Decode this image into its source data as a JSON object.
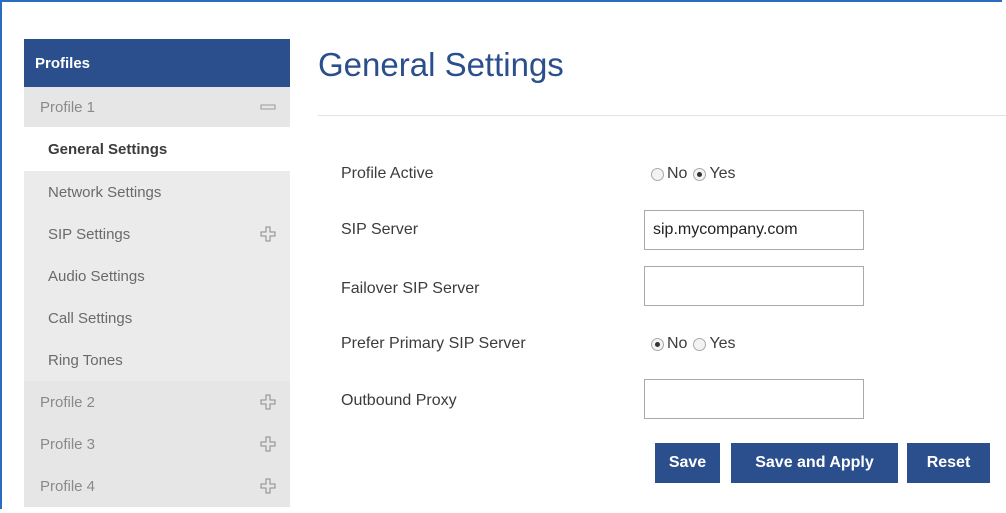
{
  "sidebar": {
    "header": "Profiles",
    "profile1": {
      "label": "Profile 1",
      "toggle_icon": "minus-icon"
    },
    "items": [
      {
        "label": "General Settings",
        "active": true
      },
      {
        "label": "Network Settings"
      },
      {
        "label": "SIP Settings",
        "toggle_icon": "plus-icon"
      },
      {
        "label": "Audio Settings"
      },
      {
        "label": "Call Settings"
      },
      {
        "label": "Ring Tones"
      }
    ],
    "profiles": [
      {
        "label": "Profile 2",
        "toggle_icon": "plus-icon"
      },
      {
        "label": "Profile 3",
        "toggle_icon": "plus-icon"
      },
      {
        "label": "Profile 4",
        "toggle_icon": "plus-icon"
      }
    ]
  },
  "main": {
    "title": "General Settings",
    "profile_active": {
      "label": "Profile Active",
      "no": "No",
      "yes": "Yes",
      "selected": "Yes"
    },
    "sip_server": {
      "label": "SIP Server",
      "value": "sip.mycompany.com"
    },
    "failover": {
      "label": "Failover SIP Server",
      "value": ""
    },
    "prefer_primary": {
      "label": "Prefer Primary SIP Server",
      "no": "No",
      "yes": "Yes",
      "selected": "No"
    },
    "outbound_proxy": {
      "label": "Outbound Proxy",
      "value": ""
    }
  },
  "buttons": {
    "save": "Save",
    "save_apply": "Save and Apply",
    "reset": "Reset"
  },
  "colors": {
    "brand": "#2b4f8c",
    "frame": "#2a6cbf"
  }
}
